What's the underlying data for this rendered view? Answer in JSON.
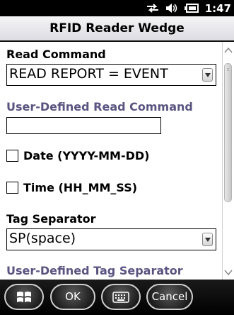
{
  "status_bar": {
    "time": "1:47",
    "icons": [
      "connectivity-icon",
      "volume-icon",
      "battery-icon"
    ]
  },
  "title": "RFID Reader Wedge",
  "form": {
    "read_command_label": "Read Command",
    "read_command_value": "READ REPORT = EVENT",
    "user_defined_read_command_label": "User-Defined Read Command",
    "user_defined_read_command_value": "",
    "date_label": "Date (YYYY-MM-DD)",
    "time_label": "Time (HH_MM_SS)",
    "tag_separator_label": "Tag Separator",
    "tag_separator_value": "SP(space)",
    "user_defined_tag_separator_label": "User-Defined Tag Separator"
  },
  "bottom_bar": {
    "start_icon": "windows-logo-icon",
    "ok_label": "OK",
    "keyboard_icon": "keyboard-icon",
    "cancel_label": "Cancel"
  },
  "colors": {
    "muted_label": "#5a5480",
    "status_bar_bg": "#000000",
    "bottom_bar_bg": "#000000"
  }
}
